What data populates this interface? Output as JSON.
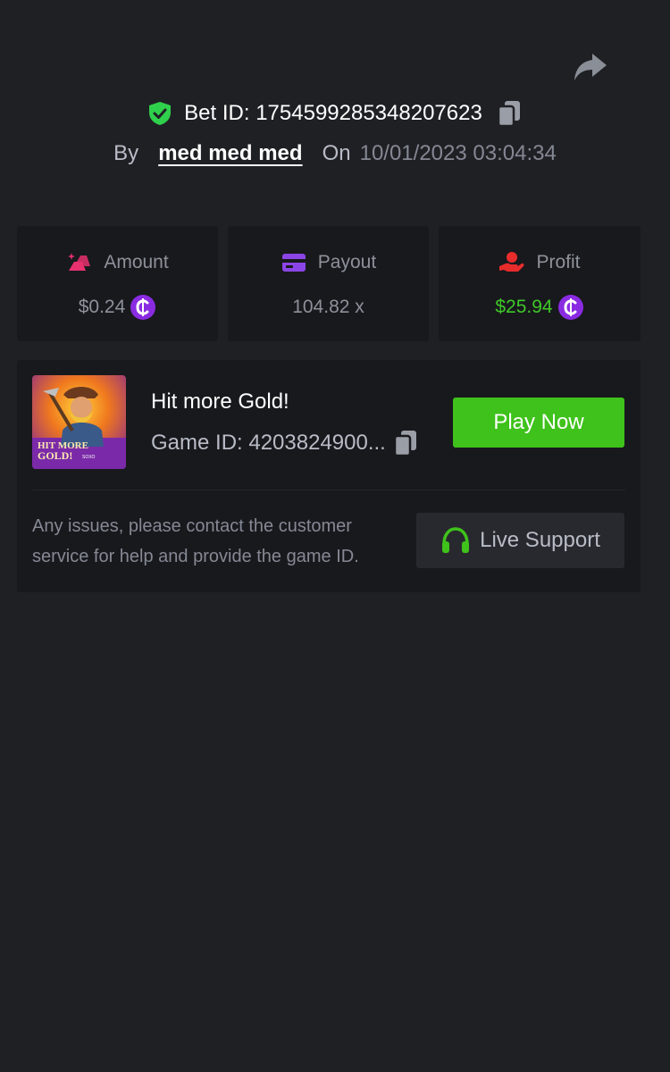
{
  "bet": {
    "id_label": "Bet ID: 1754599285348207623",
    "by_label": "By",
    "user": "med med med",
    "on_label": "On",
    "date": "10/01/2023 03:04:34"
  },
  "stats": {
    "amount": {
      "label": "Amount",
      "value": "$0.24",
      "icon": "gold-bars-icon"
    },
    "payout": {
      "label": "Payout",
      "value": "104.82 x",
      "icon": "card-icon"
    },
    "profit": {
      "label": "Profit",
      "value": "$25.94",
      "icon": "hand-coin-icon"
    }
  },
  "game": {
    "title": "Hit more Gold!",
    "game_id": "Game ID: 4203824900...",
    "thumb_text_1": "HIT MORE",
    "thumb_text_2": "GOLD!",
    "thumb_brand": "SOXO",
    "play_label": "Play Now"
  },
  "support": {
    "text": "Any issues, please contact the customer service for help and provide the game ID.",
    "button_label": "Live Support"
  },
  "colors": {
    "background": "#1f2024",
    "card": "#18191d",
    "accent_green": "#3fc21b",
    "coin_purple": "#8a2be2",
    "pink": "#e8316f"
  }
}
